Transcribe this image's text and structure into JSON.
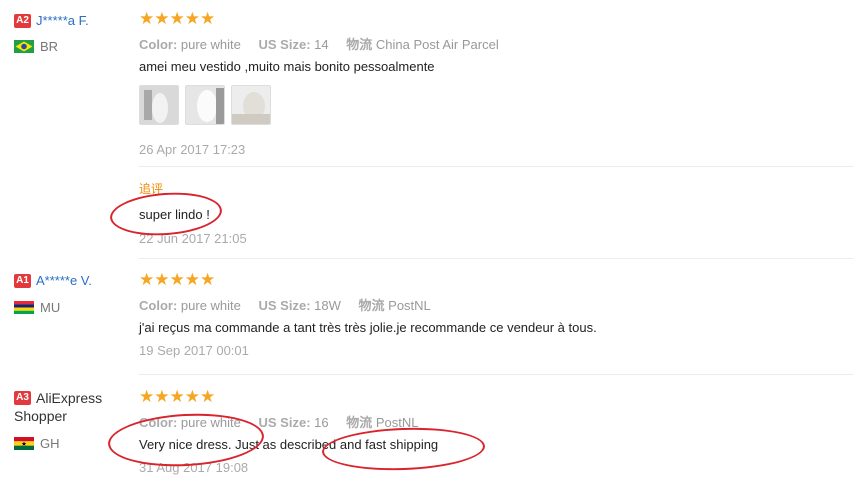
{
  "reviews": [
    {
      "badge": "A2",
      "name": "J*****a F.",
      "country": "BR",
      "stars": "★★★★★",
      "color_label": "Color:",
      "color_value": "pure white",
      "size_label": "US Size:",
      "size_value": "14",
      "ship_label": "物流",
      "ship_value": "China Post Air Parcel",
      "text": "amei meu vestido ,muito mais bonito pessoalmente",
      "date": "26 Apr 2017 17:23",
      "followup_label": "追评",
      "followup_text": "super lindo !",
      "followup_date": "22 Jun 2017 21:05"
    },
    {
      "badge": "A1",
      "name": "A*****e V.",
      "country": "MU",
      "stars": "★★★★★",
      "color_label": "Color:",
      "color_value": "pure white",
      "size_label": "US Size:",
      "size_value": "18W",
      "ship_label": "物流",
      "ship_value": "PostNL",
      "text": "j'ai reçus ma commande a tant très très jolie.je recommande ce vendeur à tous.",
      "date": "19 Sep 2017 00:01"
    },
    {
      "badge": "A3",
      "name_line1": "AliExpress",
      "name_line2": "Shopper",
      "country": "GH",
      "stars": "★★★★★",
      "color_label": "Color:",
      "color_value": "pure white",
      "size_label": "US Size:",
      "size_value": "16",
      "ship_label": "物流",
      "ship_value": "PostNL",
      "text": "Very nice dress. Just as described and fast shipping",
      "date": "31 Aug 2017 19:08"
    }
  ],
  "colors": {
    "badge": "#e4393c",
    "name_link": "#2a6ec5",
    "stars": "#f5a623",
    "followup_label": "#f08a00",
    "annotation": "#d9232d"
  }
}
